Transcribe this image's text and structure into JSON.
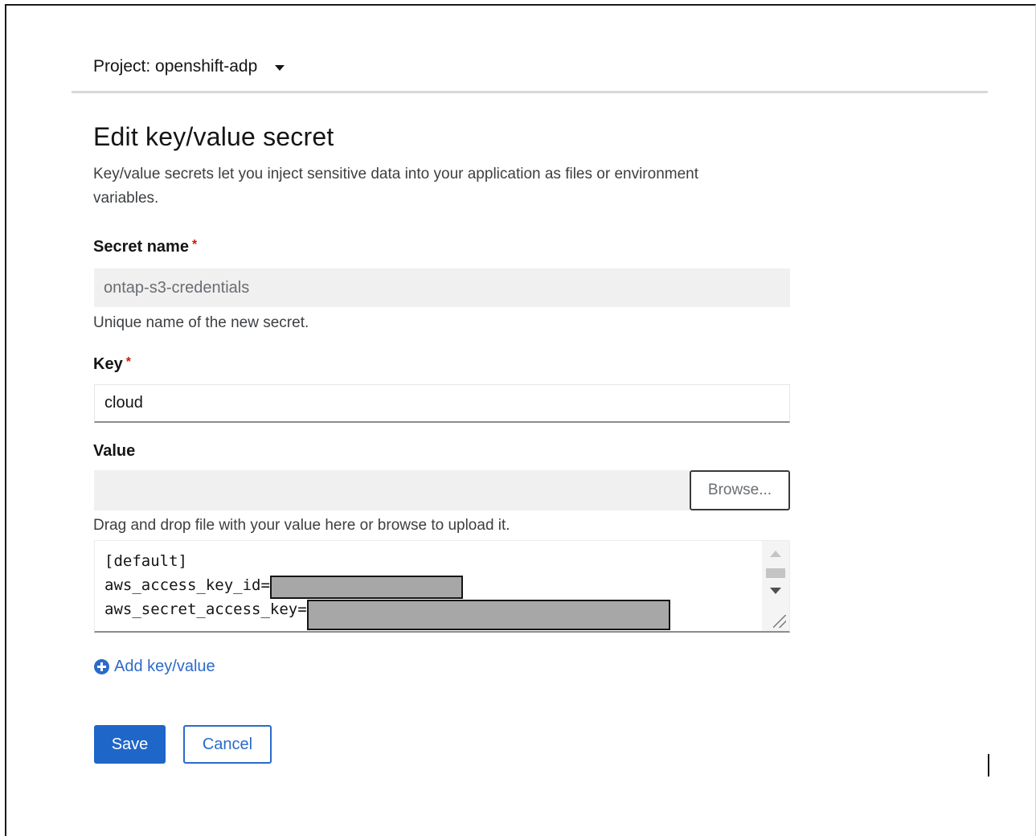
{
  "project": {
    "label": "Project: openshift-adp"
  },
  "page": {
    "title": "Edit key/value secret",
    "description": "Key/value secrets let you inject sensitive data into your application as files or environment variables."
  },
  "form": {
    "secret_name": {
      "label": "Secret name",
      "required_marker": "*",
      "value": "ontap-s3-credentials",
      "helper": "Unique name of the new secret."
    },
    "key": {
      "label": "Key",
      "required_marker": "*",
      "value": "cloud"
    },
    "value": {
      "label": "Value",
      "browse_label": "Browse...",
      "helper": "Drag and drop file with your value here or browse to upload it.",
      "lines": [
        "[default]",
        "aws_access_key_id=",
        "aws_secret_access_key="
      ]
    },
    "add_link_label": "Add key/value",
    "save_label": "Save",
    "cancel_label": "Cancel"
  },
  "colors": {
    "primary": "#1f66c9",
    "link": "#2b6acb",
    "required": "#c9190b",
    "redaction": "#a7a7a7"
  }
}
